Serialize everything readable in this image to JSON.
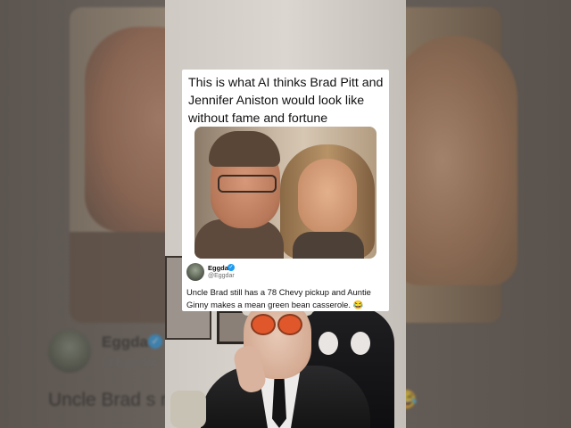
{
  "caption": "This is what AI thinks Brad Pitt and Jennifer Aniston would look like without fame and fortune",
  "tweet": {
    "name": "Eggdar",
    "handle": "@Eggdar",
    "verified_icon": "check",
    "text": "Uncle Brad still has a 78 Chevy pickup and Auntie Ginny makes a mean green bean casserole. 😂"
  },
  "background": {
    "name": "Eggdar",
    "handle": "@Eggdar",
    "text_fragment": "Uncle Brad s                                           nd Auntie Ginny makes                                            ole. 😂"
  },
  "colors": {
    "verified_blue": "#1d9bf0",
    "card_bg": "#ffffff"
  }
}
